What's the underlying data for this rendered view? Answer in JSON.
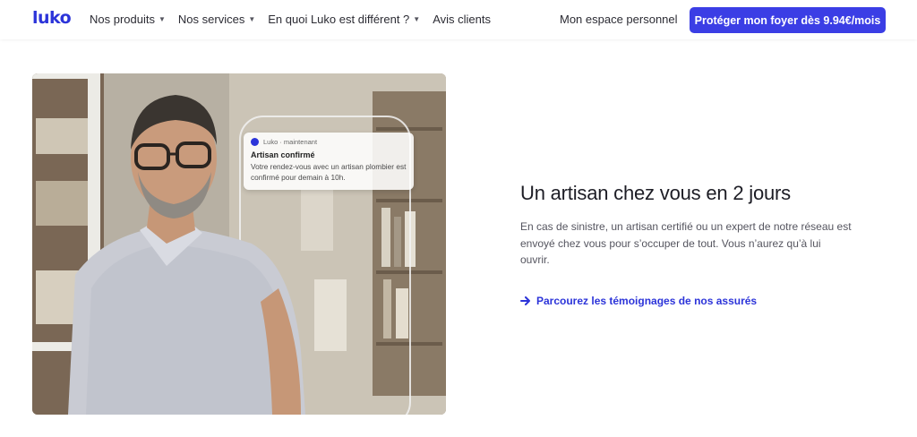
{
  "brand": {
    "logo": "luko",
    "accent": "#2c34d9",
    "button_color": "#3b3ee5"
  },
  "nav": {
    "items": [
      {
        "label": "Nos produits",
        "has_dropdown": true
      },
      {
        "label": "Nos services",
        "has_dropdown": true
      },
      {
        "label": "En quoi Luko est différent ?",
        "has_dropdown": true
      },
      {
        "label": "Avis clients",
        "has_dropdown": false
      }
    ],
    "account": "Mon espace personnel",
    "cta": "Protéger mon foyer dès 9.94€/mois"
  },
  "notification": {
    "app": "Luko · maintenant",
    "title": "Artisan confirmé",
    "body": "Votre rendez-vous avec un artisan plombier est confirmé pour demain à 10h."
  },
  "section": {
    "title": "Un artisan chez vous en 2 jours",
    "description": "En cas de sinistre, un artisan certifié ou un expert de notre réseau est envoyé chez vous pour s’occuper de tout. Vous n’aurez qu’à lui ouvrir.",
    "link": "Parcourez les témoignages de nos assurés",
    "link_icon": "arrow-right-icon"
  }
}
